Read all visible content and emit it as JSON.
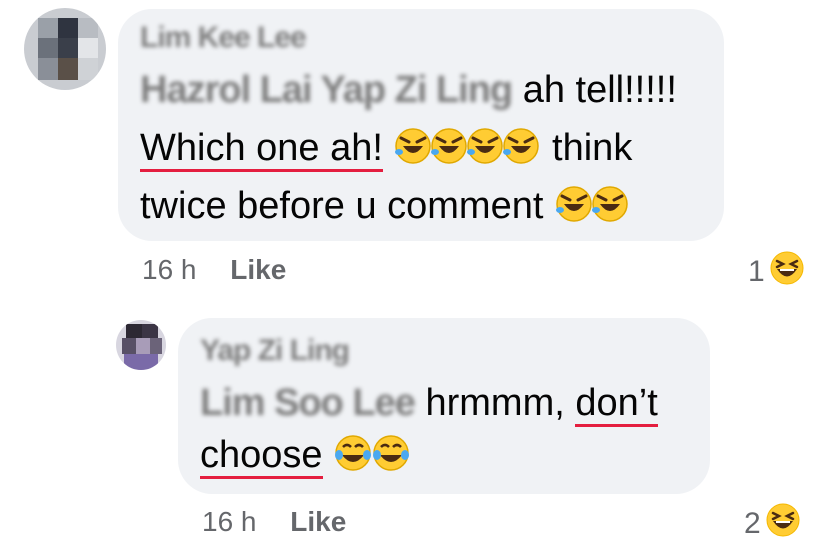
{
  "comments": [
    {
      "author": "Lim Kee Lee",
      "text_line1_mention": "Hazrol Lai Yap Zi Ling",
      "text_line1_rest": "ah tell!!!!!",
      "text_line2_underlined": "Which one ah!",
      "text_line2_rest": "think",
      "text_line3": "twice before u comment",
      "emoji_line2": "rolling-on-floor-laughing x4",
      "emoji_line3": "rolling-on-floor-laughing x2",
      "time": "16 h",
      "like_label": "Like",
      "reaction_count": "1",
      "reaction_icon": "laughing-face-icon"
    },
    {
      "author": "Yap Zi Ling",
      "text_line1_mention": "Lim Soo Lee",
      "text_line1_rest": "hrmmm, ",
      "text_line1_underlined": "don’t",
      "text_line2_underlined": "choose",
      "emoji_line2": "face-with-tears-of-joy x2",
      "time": "16 h",
      "like_label": "Like",
      "reaction_count": "2",
      "reaction_icon": "laughing-face-icon"
    }
  ],
  "colors": {
    "bubble": "#f0f2f5",
    "meta_text": "#65676b",
    "spell_underline": "#e41e3f",
    "emoji_yellow": "#ffcc33"
  }
}
